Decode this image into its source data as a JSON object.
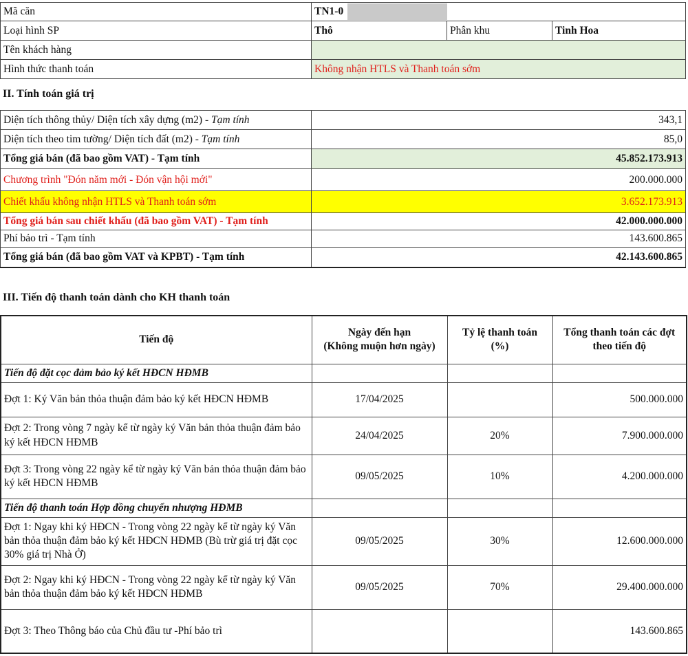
{
  "info": {
    "ma_can_label": "Mã căn",
    "ma_can_value": "TN1-0",
    "loai_hinh_label": "Loại hình SP",
    "loai_hinh_value": "Thô",
    "phan_khu_label": "Phân khu",
    "phan_khu_value": "Tinh Hoa",
    "ten_kh_label": "Tên khách hàng",
    "hinh_thuc_label": "Hình thức thanh toán",
    "hinh_thuc_value": "Không nhận HTLS và Thanh toán sớm"
  },
  "section2": {
    "title": "II. Tính toán giá trị",
    "rows": [
      {
        "label": "Diện tích thông thủy/ Diện tích xây dựng (m2) - ",
        "note": "Tạm tính",
        "value": "343,1"
      },
      {
        "label": "Diện tích theo tim tường/ Diện tích đất (m2) - ",
        "note": "Tạm tính",
        "value": "85,0"
      },
      {
        "label": "Tổng giá bán (đã bao gồm VAT)  - Tạm tính",
        "value": "45.852.173.913"
      },
      {
        "label": "Chương trình \"Đón năm mới - Đón vận hội mới\"",
        "value": "200.000.000"
      },
      {
        "label": "Chiết khấu không nhận HTLS và Thanh toán sớm",
        "value": "3.652.173.913"
      },
      {
        "label": "Tổng giá bán sau chiết khấu (đã bao gồm VAT)  - Tạm tính",
        "value": "42.000.000.000"
      },
      {
        "label": "Phí bảo trì  - Tạm tính",
        "value": "143.600.865"
      },
      {
        "label": "Tổng giá bán (đã bao gồm VAT và KPBT)  - Tạm tính",
        "value": "42.143.600.865"
      }
    ]
  },
  "section3": {
    "title": "III. Tiến độ thanh toán dành cho KH thanh toán",
    "headers": {
      "col1": "Tiến độ",
      "col2_line1": "Ngày đến hạn",
      "col2_line2": "(Không muộn hơn ngày)",
      "col3_line1": "Tỷ lệ thanh toán",
      "col3_line2": "(%)",
      "col4_line1": "Tổng thanh toán các đợt",
      "col4_line2": "theo tiến độ"
    },
    "group1": "Tiến độ đặt cọc đảm bảo ký kết HĐCN HĐMB",
    "group1_rows": [
      {
        "desc": "Đợt 1: Ký Văn bản thỏa thuận đảm bảo ký kết HĐCN HĐMB",
        "date": "17/04/2025",
        "pct": "",
        "amount": "500.000.000"
      },
      {
        "desc": "Đợt 2: Trong vòng 7 ngày kể từ ngày ký Văn bản thỏa thuận đảm bảo ký kết HĐCN HĐMB",
        "date": "24/04/2025",
        "pct": "20%",
        "amount": "7.900.000.000"
      },
      {
        "desc": "Đợt 3: Trong vòng 22 ngày kể từ ngày ký Văn bản thỏa thuận đảm bảo ký kết HĐCN HĐMB",
        "date": "09/05/2025",
        "pct": "10%",
        "amount": "4.200.000.000"
      }
    ],
    "group2": "Tiến độ thanh toán Hợp đồng chuyển nhượng HĐMB",
    "group2_rows": [
      {
        "desc": "Đợt 1: Ngay khi ký HĐCN - Trong vòng 22 ngày kể từ ngày ký Văn bản thỏa thuận đảm bảo ký kết HĐCN HĐMB (Bù trừ giá trị đặt cọc 30% giá trị Nhà Ở)",
        "date": "09/05/2025",
        "pct": "30%",
        "amount": "12.600.000.000"
      },
      {
        "desc": "Đợt 2: Ngay khi ký HĐCN - Trong vòng 22 ngày kể từ ngày ký Văn bản thỏa thuận đảm bảo ký kết HĐCN HĐMB",
        "date": "09/05/2025",
        "pct": "70%",
        "amount": "29.400.000.000"
      },
      {
        "desc": "Đợt 3: Theo Thông báo của Chủ đầu tư -Phí bảo trì",
        "date": "",
        "pct": "",
        "amount": "143.600.865"
      }
    ]
  }
}
